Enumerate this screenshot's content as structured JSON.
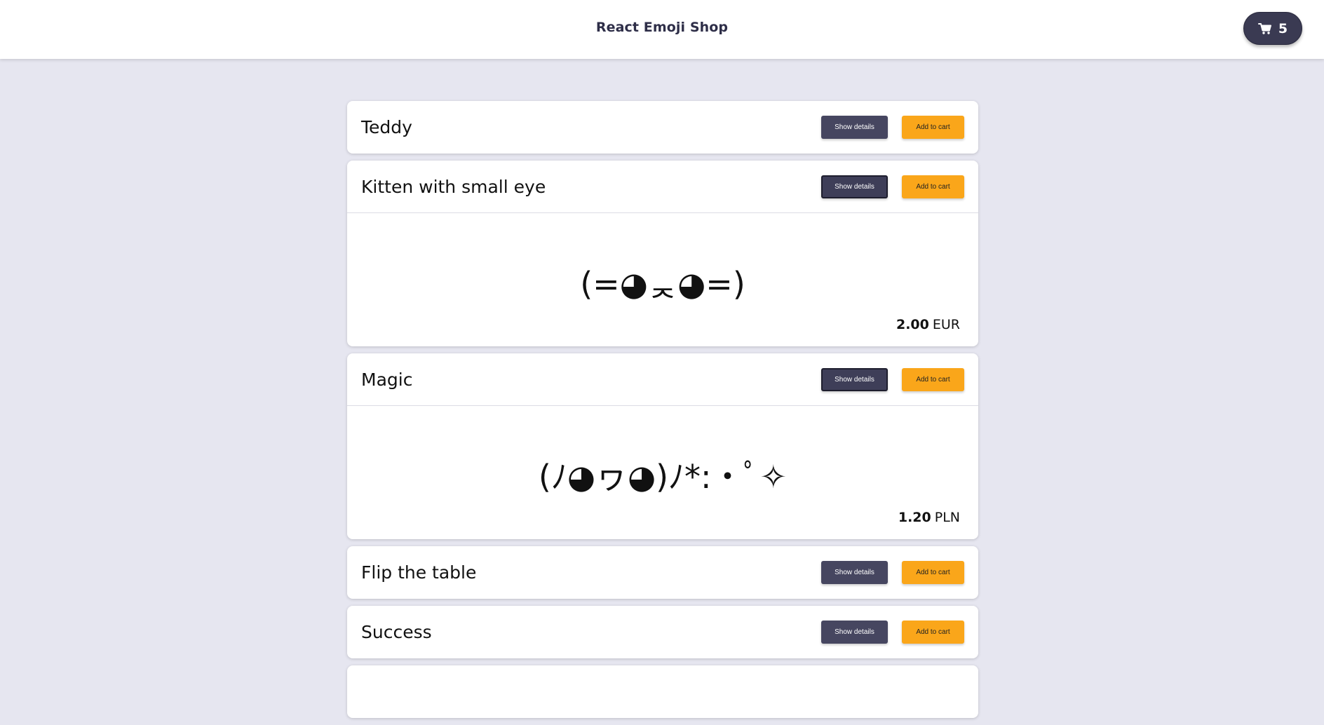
{
  "header": {
    "title": "React Emoji Shop",
    "cart_icon": "shopping-cart-icon",
    "cart_count": "5"
  },
  "labels": {
    "show_details": "Show details",
    "add_to_cart": "Add to cart"
  },
  "colors": {
    "background": "#e6e6f0",
    "details_button": "#464660",
    "add_button": "#faa61a",
    "cart_button": "#3a3a52"
  },
  "products": [
    {
      "name": "Teddy",
      "expanded": false
    },
    {
      "name": "Kitten with small eye",
      "expanded": true,
      "emoji": "(=◕ᆽ◕=)",
      "price": "2.00",
      "currency": "EUR"
    },
    {
      "name": "Magic",
      "expanded": true,
      "emoji": "(ﾉ◕ヮ◕)ﾉ*:・ﾟ✧",
      "price": "1.20",
      "currency": "PLN"
    },
    {
      "name": "Flip the table",
      "expanded": false
    },
    {
      "name": "Success",
      "expanded": false
    }
  ]
}
